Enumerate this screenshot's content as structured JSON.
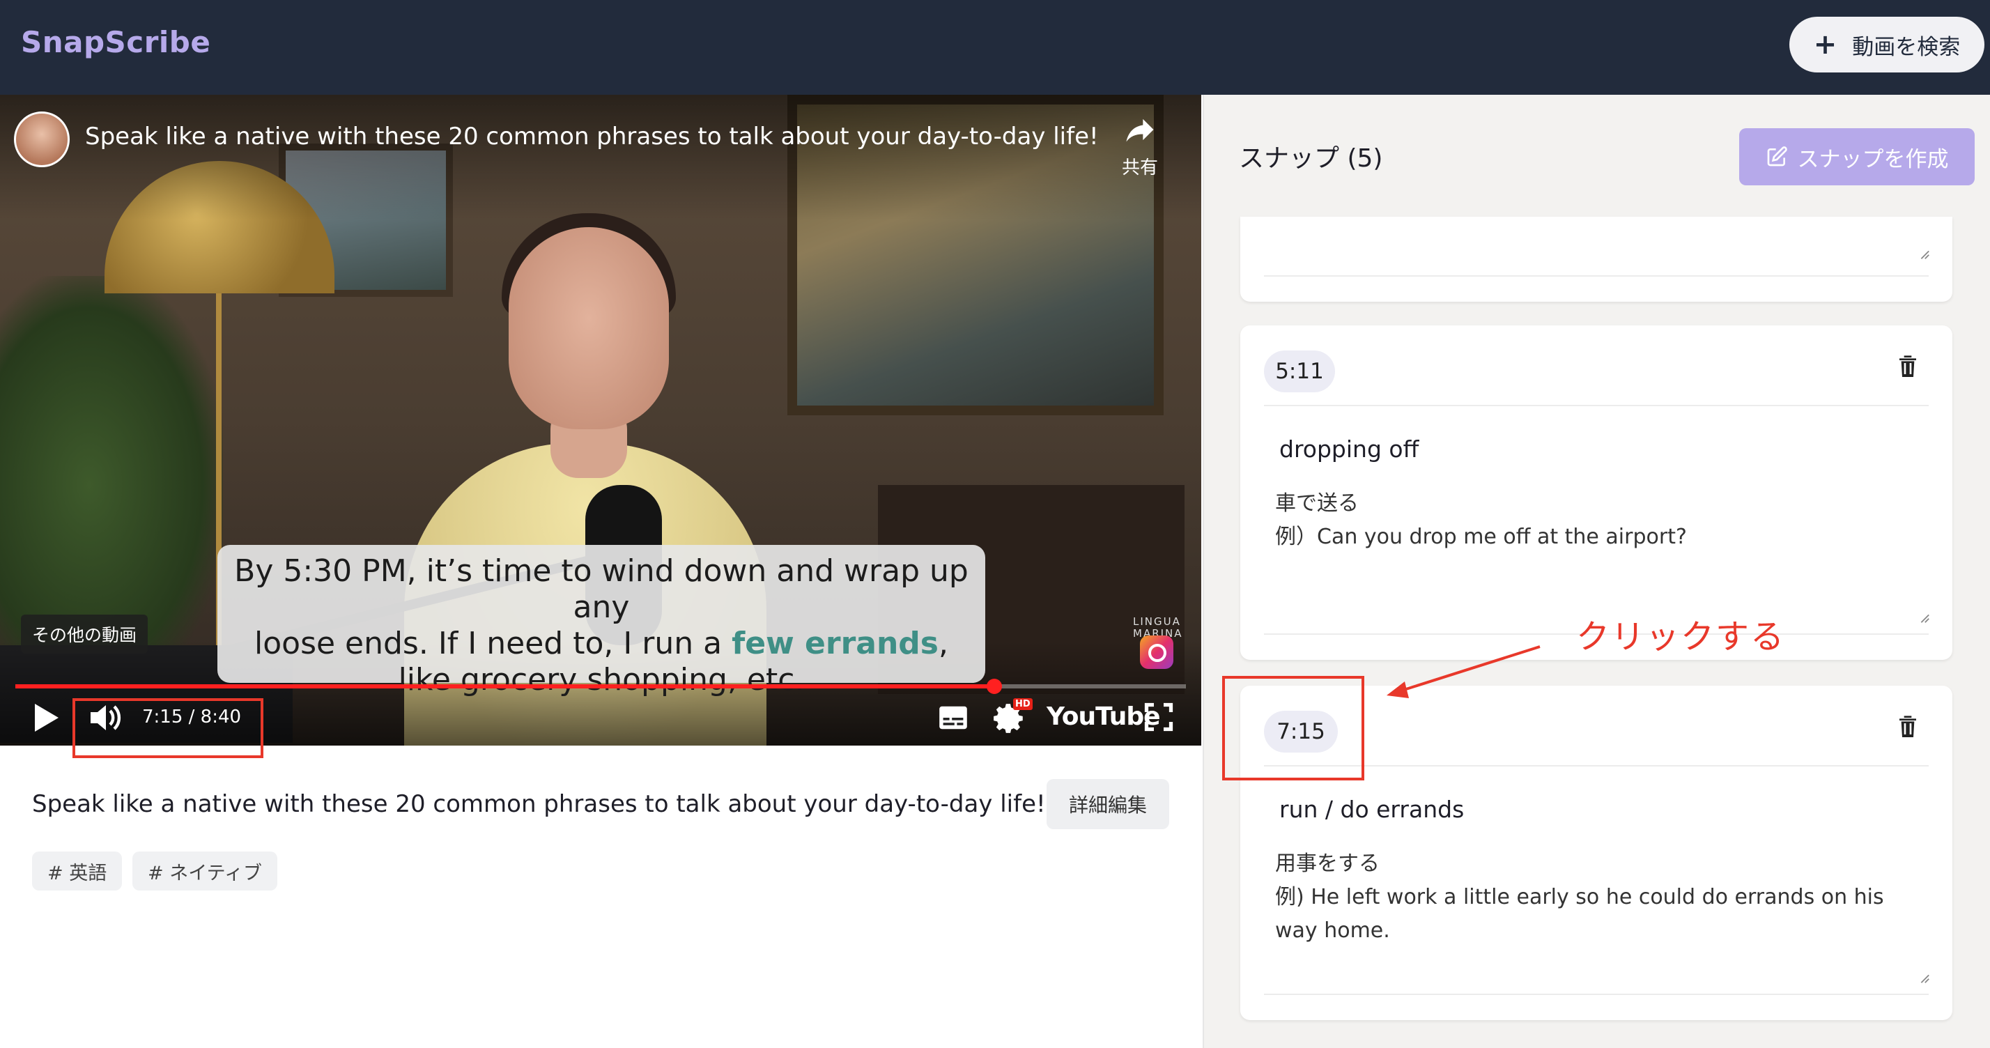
{
  "header": {
    "logo": "SnapScribe",
    "search_button_label": "動画を検索"
  },
  "video": {
    "title": "Speak like a native with these 20 common phrases to talk about your day-to-day life!",
    "share_label": "共有",
    "more_videos_label": "その他の動画",
    "watermark": "LINGUA MARINA",
    "caption": {
      "line1": "By 5:30 PM, it’s time to wind down and wrap up any",
      "line2_before": "loose ends. If I need to, I run a ",
      "line2_highlight": "few errands",
      "line2_after": ",",
      "line3": "like grocery shopping, etc."
    },
    "time_display": "7:15 / 8:40",
    "progress_fraction": 0.8365,
    "youtube_label": "YouTube",
    "hd_badge": "HD"
  },
  "details": {
    "title": "Speak like a native with these 20 common phrases to talk about your day-to-day life!",
    "edit_button_label": "詳細編集",
    "tags": [
      "# 英語",
      "# ネイティブ"
    ]
  },
  "panel": {
    "heading": "スナップ (5)",
    "create_button_label": "スナップを作成",
    "snaps": [
      {
        "timestamp": "5:11",
        "phrase": "dropping off",
        "note": "車で送る\n例）Can you drop me off at the airport?"
      },
      {
        "timestamp": "7:15",
        "phrase": "run / do errands",
        "note": "用事をする\n例) He left work a little early so he could do errands on his way home."
      }
    ]
  },
  "annotation": {
    "text": "クリックする"
  },
  "colors": {
    "header_bg": "#222b3c",
    "brand": "#b6a9ea",
    "annotation_red": "#e8382a",
    "progress_red": "#ff2020",
    "caption_highlight": "#3f8f86"
  }
}
